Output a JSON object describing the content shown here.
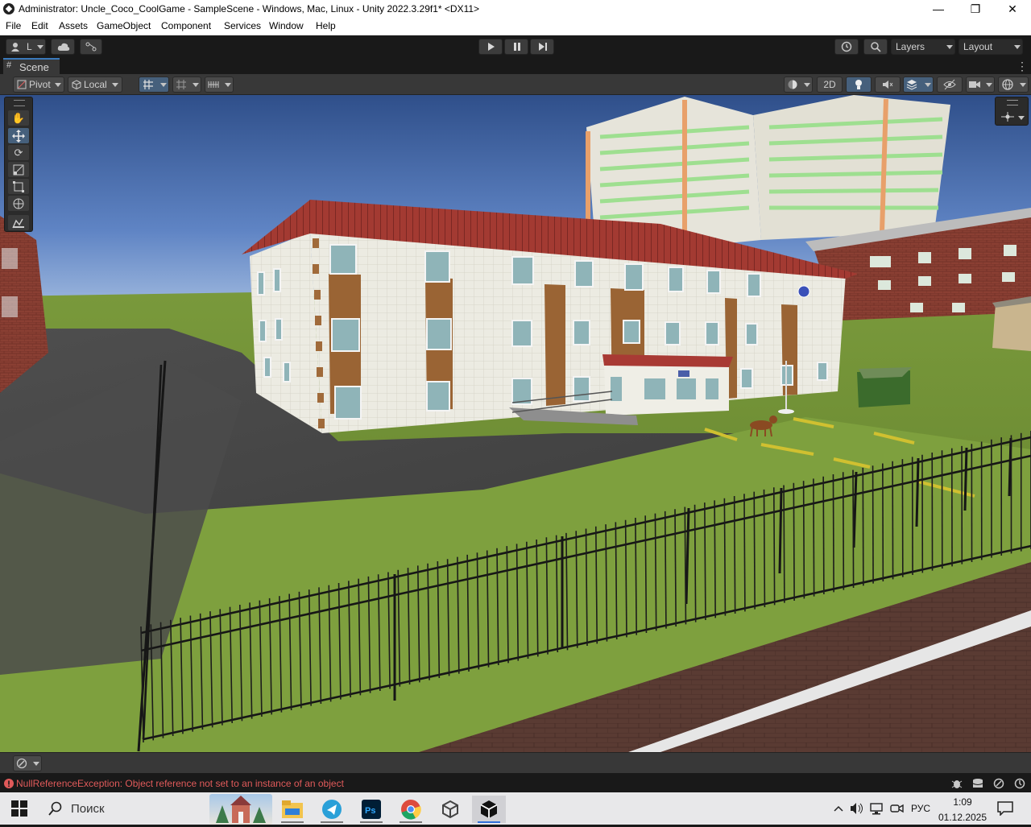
{
  "window": {
    "title": "Administrator: Uncle_Coco_CoolGame - SampleScene - Windows, Mac, Linux - Unity 2022.3.29f1* <DX11>",
    "controls": {
      "minimize": "—",
      "maximize": "❐",
      "close": "✕"
    }
  },
  "menu": [
    "File",
    "Edit",
    "Assets",
    "GameObject",
    "Component",
    "Services",
    "Window",
    "Help"
  ],
  "toolbar": {
    "account_label": "L",
    "layers_label": "Layers",
    "layout_label": "Layout"
  },
  "scene_tab": {
    "label": "Scene"
  },
  "scene_toolbar": {
    "pivot_label": "Pivot",
    "local_label": "Local",
    "mode_2d_label": "2D"
  },
  "console": {
    "error_message": "NullReferenceException: Object reference not set to an instance of an object",
    "status_color": "#e05a5a"
  },
  "taskbar": {
    "search_placeholder": "Поиск",
    "language": "РУС",
    "time": "1:09",
    "date": "01.12.2025"
  },
  "colors": {
    "editor_bg": "#191919",
    "toolbar_bg": "#383838",
    "active_blue": "#46607c",
    "accent": "#3a79bb"
  }
}
